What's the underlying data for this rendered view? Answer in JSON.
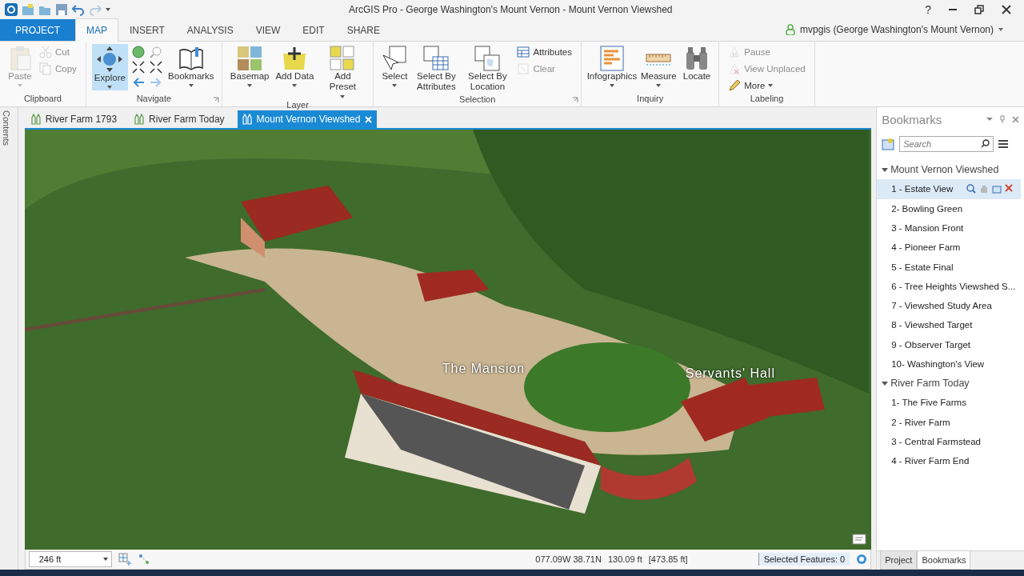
{
  "window": {
    "title": "ArcGIS Pro - George Washington's Mount Vernon - Mount Vernon Viewshed",
    "help": "?"
  },
  "ribbon_tabs": [
    {
      "label": "PROJECT",
      "kind": "backstage",
      "selected": false
    },
    {
      "label": "MAP",
      "kind": "tab",
      "selected": true
    },
    {
      "label": "INSERT",
      "kind": "tab",
      "selected": false
    },
    {
      "label": "ANALYSIS",
      "kind": "tab",
      "selected": false
    },
    {
      "label": "VIEW",
      "kind": "tab",
      "selected": false
    },
    {
      "label": "EDIT",
      "kind": "tab",
      "selected": false
    },
    {
      "label": "SHARE",
      "kind": "tab",
      "selected": false
    }
  ],
  "user": "mvpgis (George Washington's Mount Vernon)",
  "ribbon": {
    "groups": [
      {
        "name": "Clipboard",
        "launcher": false,
        "commands": [
          {
            "kind": "large",
            "label": "Paste",
            "disabled": true,
            "selected": false,
            "dropdown": true
          },
          {
            "kind": "small",
            "label": "Cut",
            "disabled": true,
            "selected": false,
            "dropdown": false
          },
          {
            "kind": "small",
            "label": "Copy",
            "disabled": true,
            "selected": false,
            "dropdown": false
          }
        ]
      },
      {
        "name": "Navigate",
        "launcher": true,
        "commands": [
          {
            "kind": "large",
            "label": "Explore",
            "disabled": false,
            "selected": true,
            "dropdown": true
          },
          {
            "kind": "nav_grid"
          },
          {
            "kind": "large",
            "label": "Bookmarks",
            "disabled": false,
            "selected": false,
            "dropdown": true
          }
        ]
      },
      {
        "name": "Layer",
        "launcher": false,
        "commands": [
          {
            "kind": "large",
            "label": "Basemap",
            "disabled": false,
            "selected": false,
            "dropdown": true
          },
          {
            "kind": "large",
            "label": "Add Data",
            "disabled": false,
            "selected": false,
            "dropdown": true
          },
          {
            "kind": "large",
            "label": "Add Preset",
            "disabled": false,
            "selected": false,
            "dropdown": true
          }
        ]
      },
      {
        "name": "Selection",
        "launcher": true,
        "commands": [
          {
            "kind": "large",
            "label": "Select",
            "disabled": false,
            "selected": false,
            "dropdown": true
          },
          {
            "kind": "large",
            "label": "Select By Attributes",
            "disabled": false,
            "selected": false,
            "dropdown": false
          },
          {
            "kind": "large",
            "label": "Select By Location",
            "disabled": false,
            "selected": false,
            "dropdown": false
          },
          {
            "kind": "small",
            "label": "Attributes",
            "disabled": false,
            "selected": false,
            "dropdown": false
          },
          {
            "kind": "small",
            "label": "Clear",
            "disabled": true,
            "selected": false,
            "dropdown": false
          }
        ]
      },
      {
        "name": "Inquiry",
        "launcher": false,
        "commands": [
          {
            "kind": "large",
            "label": "Infographics",
            "disabled": false,
            "selected": false,
            "dropdown": true
          },
          {
            "kind": "large",
            "label": "Measure",
            "disabled": false,
            "selected": false,
            "dropdown": true
          },
          {
            "kind": "large",
            "label": "Locate",
            "disabled": false,
            "selected": false,
            "dropdown": false
          }
        ]
      },
      {
        "name": "Labeling",
        "launcher": false,
        "commands": [
          {
            "kind": "small",
            "label": "Pause",
            "disabled": true,
            "selected": false,
            "dropdown": false
          },
          {
            "kind": "small",
            "label": "View Unplaced",
            "disabled": true,
            "selected": false,
            "dropdown": false
          },
          {
            "kind": "small",
            "label": "More",
            "disabled": false,
            "selected": false,
            "dropdown": true
          }
        ]
      }
    ]
  },
  "side_pane": {
    "label": "Contents"
  },
  "doc_tabs": [
    {
      "label": "River Farm 1793",
      "selected": false
    },
    {
      "label": "River Farm Today",
      "selected": false
    },
    {
      "label": "Mount Vernon Viewshed",
      "selected": true
    }
  ],
  "map": {
    "labels": [
      "The Mansion",
      "Servants' Hall"
    ]
  },
  "status_bar": {
    "scale": "246 ft",
    "coordinates": "077.09W 38.71N",
    "elevation": "130.09 ft",
    "distance": "[473.85 ft]",
    "selected_features": "Selected Features: 0"
  },
  "bookmarks_pane": {
    "title": "Bookmarks",
    "search": {
      "placeholder": "Search"
    },
    "groups": [
      {
        "name": "Mount Vernon Viewshed",
        "expanded": true,
        "items": [
          {
            "label": "1 - Estate View",
            "selected": true
          },
          {
            "label": "2- Bowling Green",
            "selected": false
          },
          {
            "label": "3 - Mansion Front",
            "selected": false
          },
          {
            "label": "4 - Pioneer Farm",
            "selected": false
          },
          {
            "label": "5 - Estate Final",
            "selected": false
          },
          {
            "label": "6 - Tree Heights Viewshed S...",
            "selected": false
          },
          {
            "label": "7 - Viewshed Study Area",
            "selected": false
          },
          {
            "label": "8 - Viewshed Target",
            "selected": false
          },
          {
            "label": "9 - Observer Target",
            "selected": false
          },
          {
            "label": "10- Washington's View",
            "selected": false
          }
        ]
      },
      {
        "name": "River Farm Today",
        "expanded": true,
        "items": [
          {
            "label": "1- The Five Farms",
            "selected": false
          },
          {
            "label": "2 - River Farm",
            "selected": false
          },
          {
            "label": "3 - Central Farmstead",
            "selected": false
          },
          {
            "label": "4 - River Farm End",
            "selected": false
          }
        ]
      }
    ],
    "tabs": [
      {
        "label": "Project",
        "selected": false
      },
      {
        "label": "Bookmarks",
        "selected": true
      }
    ]
  }
}
